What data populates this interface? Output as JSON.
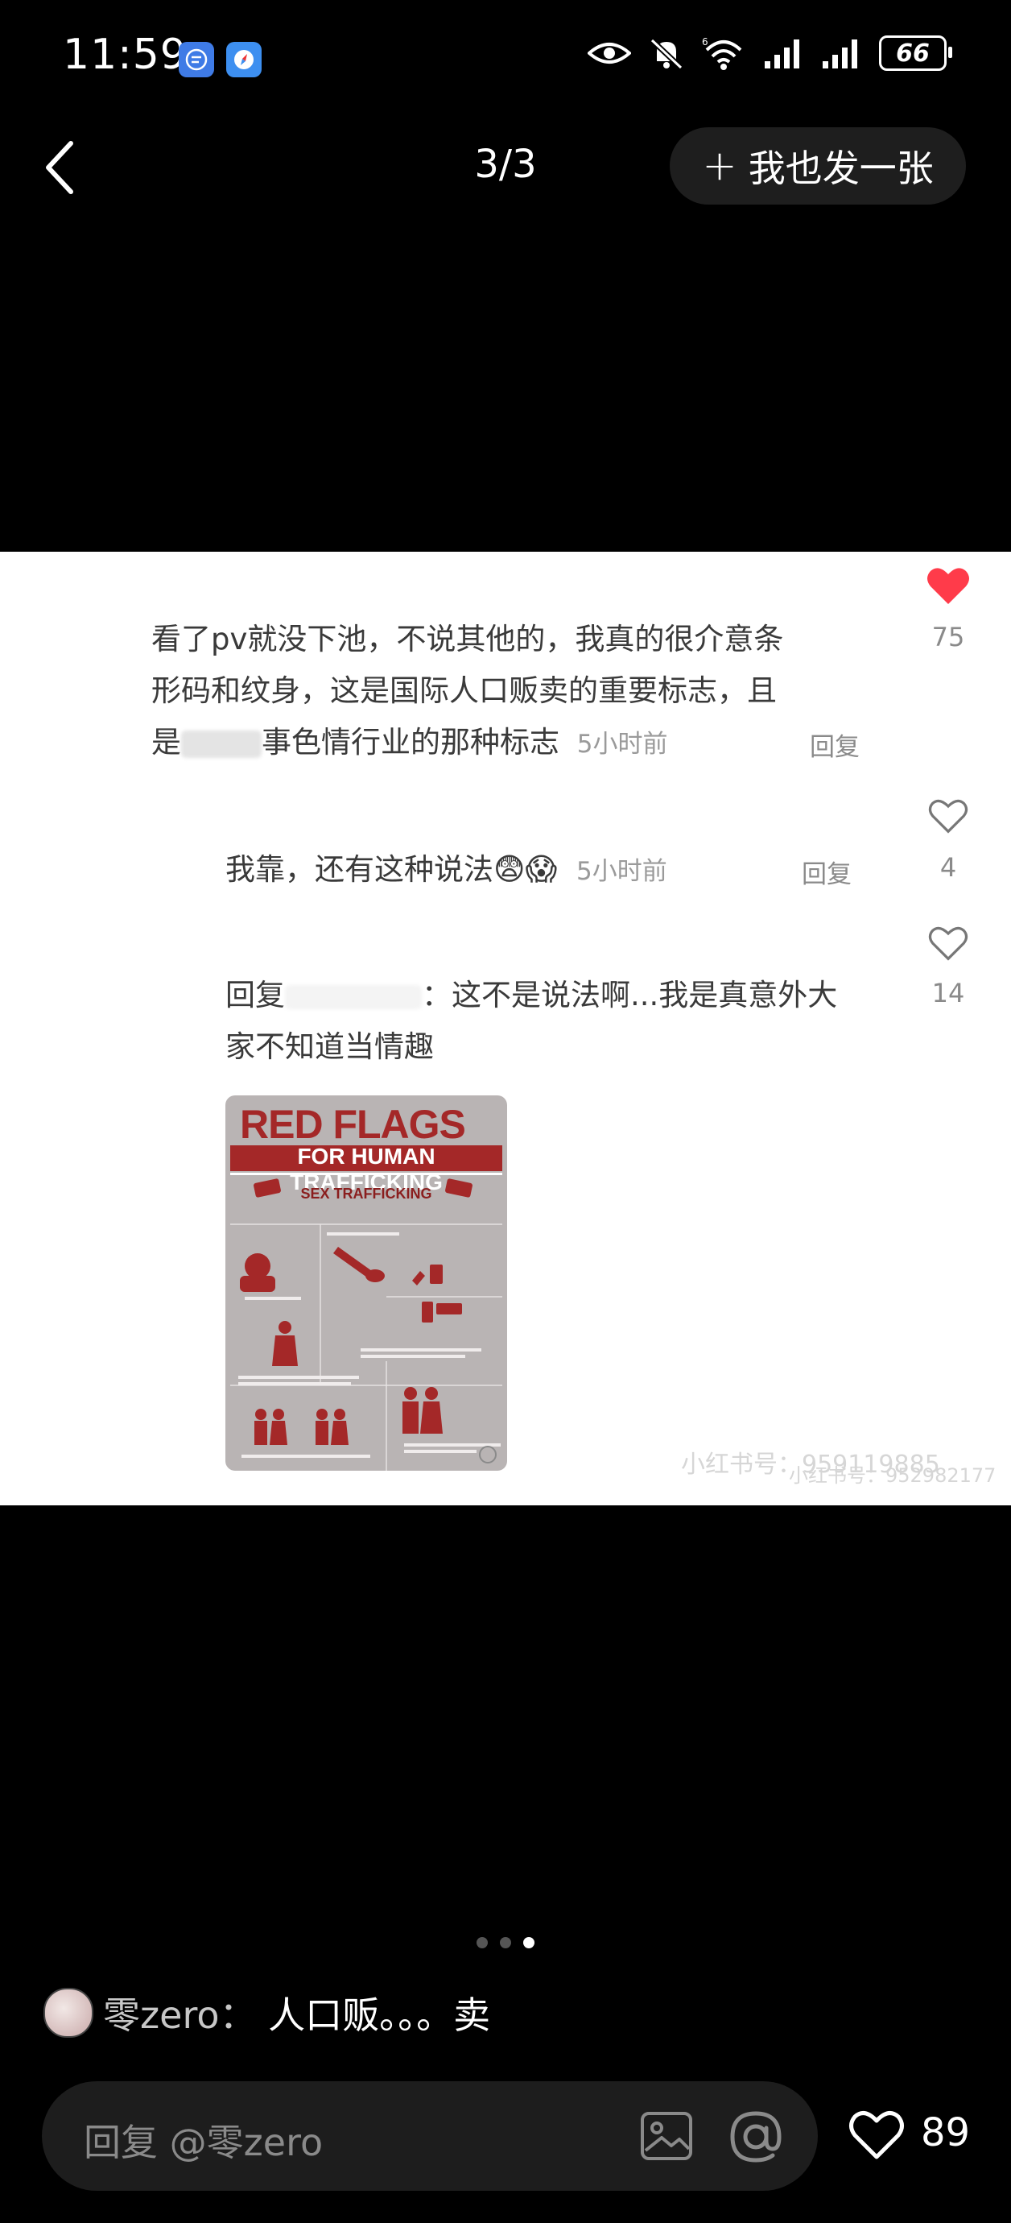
{
  "status_bar": {
    "time": "11:59",
    "battery": "66",
    "icons": [
      "app-icon-blue",
      "app-icon-compass",
      "eye-icon",
      "bell-muted-icon",
      "wifi-icon",
      "signal-icon",
      "signal-icon",
      "battery-icon"
    ]
  },
  "nav": {
    "counter": "3/3",
    "post_button_plus": "+",
    "post_button_label": "我也发一张"
  },
  "comments": [
    {
      "text_line1": "看了pv就没下池，不说其他的，我真的很介意条",
      "text_line2": "形码和纹身，这是国际人口贩卖的重要标志，且",
      "text_line3a": "是",
      "text_line3b": "事色情行业的那种标志",
      "time": "5小时前",
      "reply_label": "回复",
      "likes": "75",
      "liked": true
    },
    {
      "text": "我靠，还有这种说法",
      "time": "5小时前",
      "reply_label": "回复",
      "likes": "4",
      "liked": false
    },
    {
      "text_prefix": "回复",
      "text_line1": "：这不是说法啊...我是真意外大",
      "text_line2": "家不知道当情趣",
      "likes": "14",
      "liked": false
    }
  ],
  "infographic": {
    "title": "RED FLAGS",
    "subtitle": "FOR HUMAN TRAFFICKING",
    "section": "SEX TRAFFICKING"
  },
  "watermark": {
    "text1": "小红书号：959119885",
    "text2": "小红书号：952982177"
  },
  "pager": {
    "total": 3,
    "active": 3
  },
  "caption": {
    "username": "零zero",
    "separator": "：",
    "text": "人口贩。。。卖"
  },
  "bottom": {
    "reply_placeholder": "回复 @零zero",
    "like_count": "89"
  },
  "colors": {
    "like_red": "#ff3b4a",
    "infographic_red": "#a42828"
  }
}
